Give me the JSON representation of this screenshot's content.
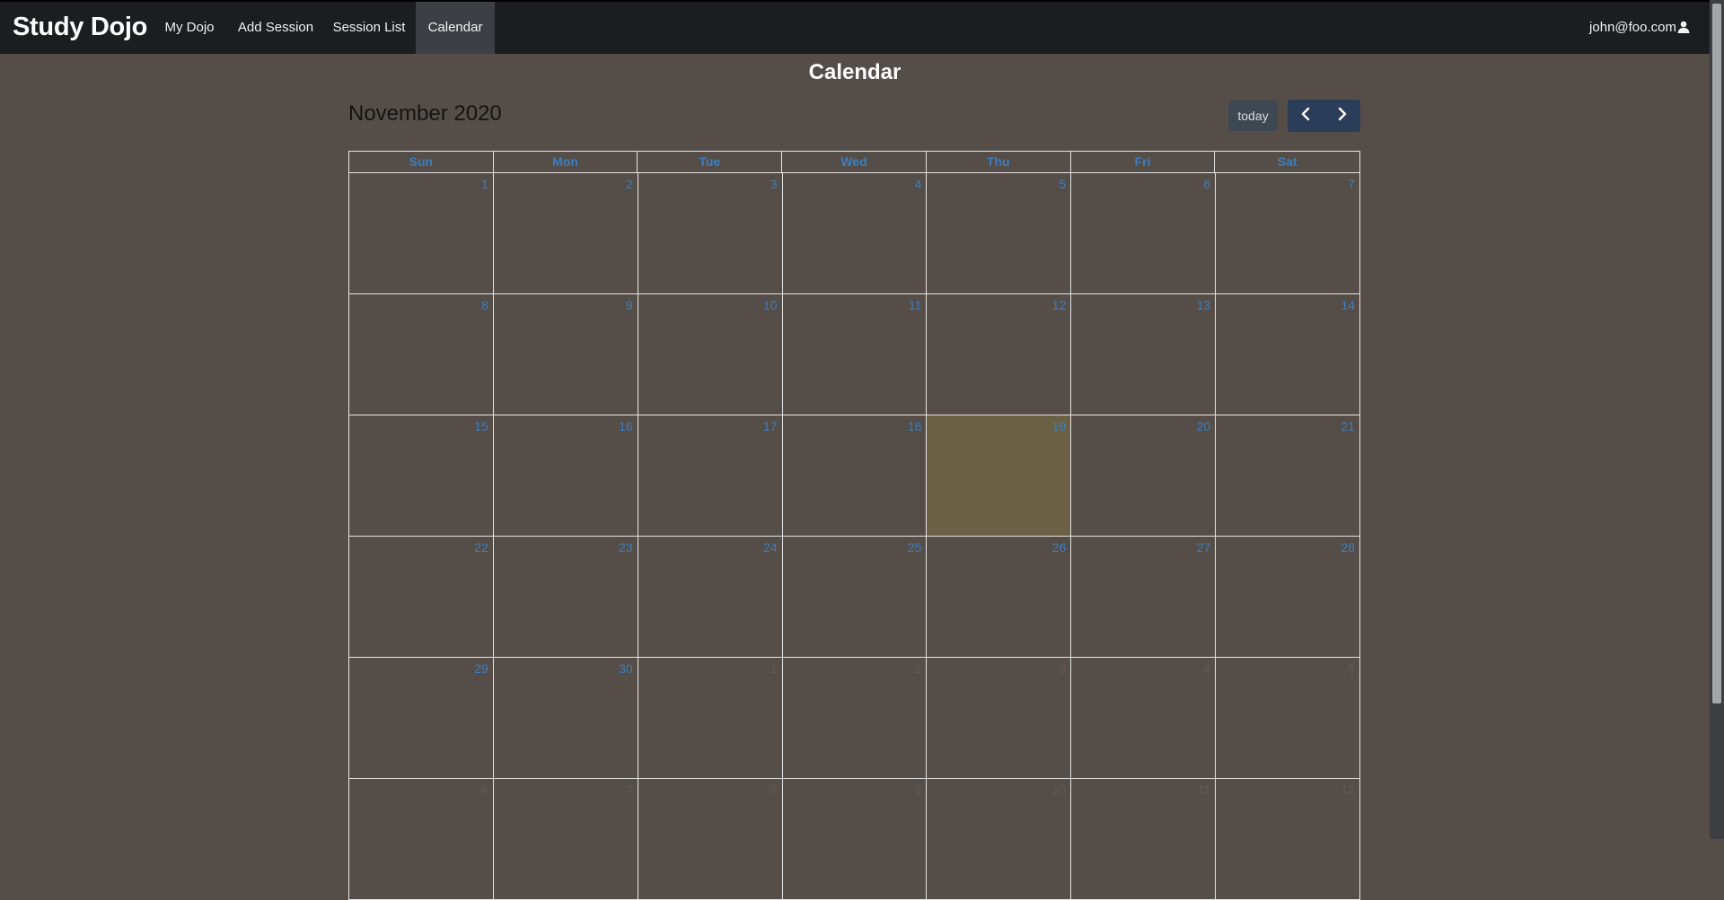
{
  "app": {
    "brand": "Study Dojo"
  },
  "nav": {
    "items": [
      {
        "label": "My Dojo"
      },
      {
        "label": "Add Session"
      },
      {
        "label": "Session List"
      },
      {
        "label": "Calendar"
      }
    ],
    "active_index": 3,
    "user": "john@foo.com",
    "user_icon": "user-icon"
  },
  "page": {
    "title": "Calendar"
  },
  "calendar": {
    "month_title": "November 2020",
    "today_label": "today",
    "prev_icon": "chevron-left-icon",
    "next_icon": "chevron-right-icon",
    "weekdays": [
      "Sun",
      "Mon",
      "Tue",
      "Wed",
      "Thu",
      "Fri",
      "Sat"
    ],
    "weeks": [
      [
        {
          "n": "1"
        },
        {
          "n": "2"
        },
        {
          "n": "3"
        },
        {
          "n": "4"
        },
        {
          "n": "5"
        },
        {
          "n": "6"
        },
        {
          "n": "7"
        }
      ],
      [
        {
          "n": "8"
        },
        {
          "n": "9"
        },
        {
          "n": "10"
        },
        {
          "n": "11"
        },
        {
          "n": "12"
        },
        {
          "n": "13"
        },
        {
          "n": "14"
        }
      ],
      [
        {
          "n": "15"
        },
        {
          "n": "16"
        },
        {
          "n": "17"
        },
        {
          "n": "18"
        },
        {
          "n": "19",
          "today": true
        },
        {
          "n": "20"
        },
        {
          "n": "21"
        }
      ],
      [
        {
          "n": "22"
        },
        {
          "n": "23"
        },
        {
          "n": "24"
        },
        {
          "n": "25"
        },
        {
          "n": "26"
        },
        {
          "n": "27"
        },
        {
          "n": "28"
        }
      ],
      [
        {
          "n": "29"
        },
        {
          "n": "30"
        },
        {
          "n": "1",
          "other": true
        },
        {
          "n": "2",
          "other": true
        },
        {
          "n": "3",
          "other": true
        },
        {
          "n": "4",
          "other": true
        },
        {
          "n": "5",
          "other": true
        }
      ],
      [
        {
          "n": "6",
          "other": true
        },
        {
          "n": "7",
          "other": true
        },
        {
          "n": "8",
          "other": true
        },
        {
          "n": "9",
          "other": true
        },
        {
          "n": "10",
          "other": true
        },
        {
          "n": "11",
          "other": true
        },
        {
          "n": "12",
          "other": true
        }
      ]
    ],
    "colors": {
      "day_number": "#3c7ec0",
      "today_bg": "#6b6043",
      "page_bg": "#554d47"
    }
  }
}
